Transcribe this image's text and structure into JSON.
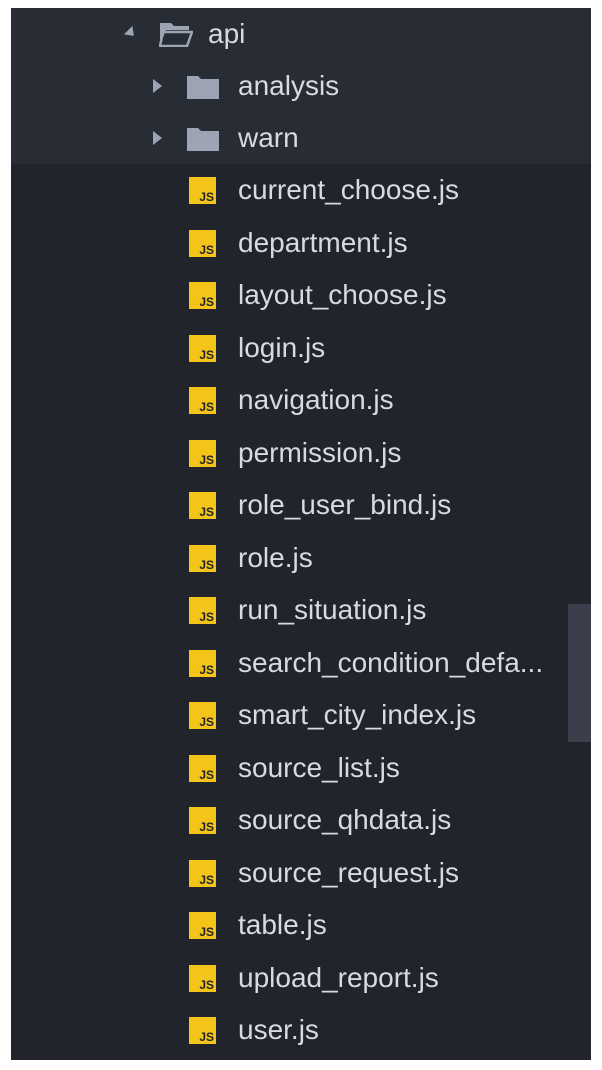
{
  "tree": {
    "root": {
      "name": "api",
      "icon": "folder-open-icon",
      "expanded": true
    },
    "folders": [
      {
        "name": "analysis",
        "icon": "folder-icon",
        "expanded": false
      },
      {
        "name": "warn",
        "icon": "folder-icon",
        "expanded": false
      }
    ],
    "files": [
      {
        "name": "current_choose.js",
        "icon": "js-file-icon"
      },
      {
        "name": "department.js",
        "icon": "js-file-icon"
      },
      {
        "name": "layout_choose.js",
        "icon": "js-file-icon"
      },
      {
        "name": "login.js",
        "icon": "js-file-icon"
      },
      {
        "name": "navigation.js",
        "icon": "js-file-icon"
      },
      {
        "name": "permission.js",
        "icon": "js-file-icon"
      },
      {
        "name": "role_user_bind.js",
        "icon": "js-file-icon"
      },
      {
        "name": "role.js",
        "icon": "js-file-icon"
      },
      {
        "name": "run_situation.js",
        "icon": "js-file-icon"
      },
      {
        "name": "search_condition_defa...",
        "icon": "js-file-icon"
      },
      {
        "name": "smart_city_index.js",
        "icon": "js-file-icon"
      },
      {
        "name": "source_list.js",
        "icon": "js-file-icon"
      },
      {
        "name": "source_qhdata.js",
        "icon": "js-file-icon"
      },
      {
        "name": "source_request.js",
        "icon": "js-file-icon"
      },
      {
        "name": "table.js",
        "icon": "js-file-icon"
      },
      {
        "name": "upload_report.js",
        "icon": "js-file-icon"
      },
      {
        "name": "user.js",
        "icon": "js-file-icon"
      }
    ],
    "js_badge": "JS"
  },
  "colors": {
    "background": "#21252b",
    "row_highlight": "#282c34",
    "text": "#d7dae0",
    "folder_icon": "#9da5b4",
    "js_icon": "#f5c419",
    "scrollbar": "#3a3f4b"
  }
}
